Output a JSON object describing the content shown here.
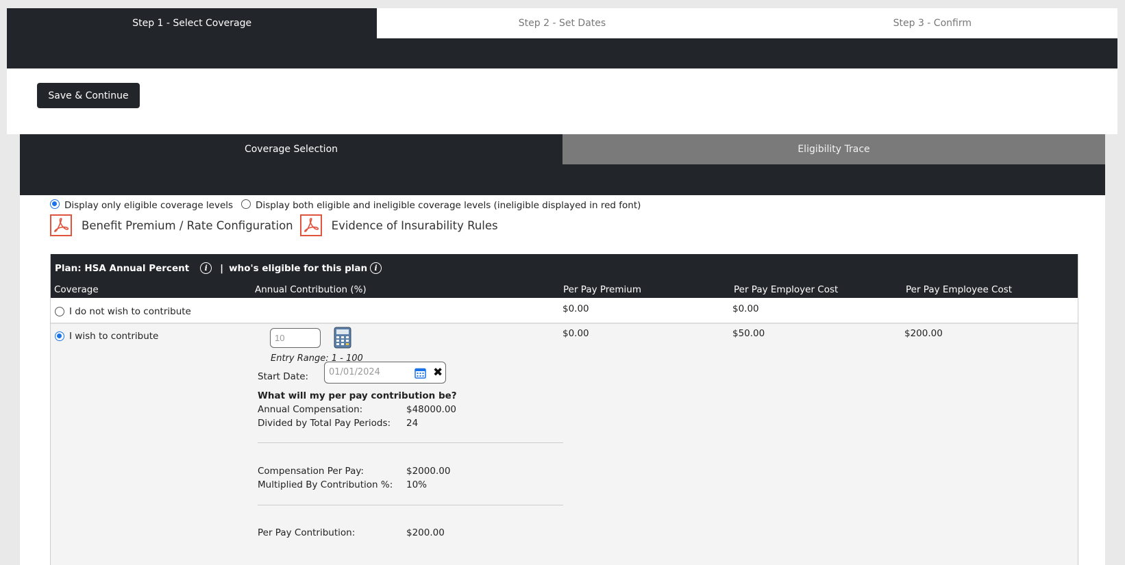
{
  "wizard": {
    "steps": [
      {
        "label": "Step 1 - Select Coverage"
      },
      {
        "label": "Step 2 - Set Dates"
      },
      {
        "label": "Step 3 - Confirm"
      }
    ]
  },
  "toolbar": {
    "save_label": "Save & Continue"
  },
  "subtabs": [
    {
      "label": "Coverage Selection"
    },
    {
      "label": "Eligibility Trace"
    }
  ],
  "display_options": {
    "eligible_only": "Display only eligible coverage levels",
    "both": "Display both eligible and ineligible coverage levels (ineligible displayed in red font)",
    "selected": "eligible_only"
  },
  "documents": [
    {
      "label": "Benefit Premium / Rate Configuration",
      "icon": "pdf-icon"
    },
    {
      "label": "Evidence of Insurability Rules",
      "icon": "pdf-icon"
    }
  ],
  "plan": {
    "title": "Plan: HSA Annual Percent",
    "separator": "|",
    "eligibility_link": "who's eligible for this plan",
    "columns": {
      "coverage": "Coverage",
      "contribution": "Annual Contribution (%)",
      "premium": "Per Pay Premium",
      "employer": "Per Pay Employer Cost",
      "employee": "Per Pay Employee Cost"
    },
    "rows": [
      {
        "label": "I do not wish to contribute",
        "premium": "$0.00",
        "employer": "$0.00",
        "employee": "",
        "selected": false
      },
      {
        "label": "I wish to contribute",
        "premium": "$0.00",
        "employer": "$50.00",
        "employee": "$200.00",
        "selected": true
      }
    ],
    "contribution": {
      "value": "10",
      "range": "Entry Range: 1 - 100",
      "start_date_label": "Start Date:",
      "start_date": "01/01/2024",
      "question": "What will my per pay contribution be?",
      "annual_comp_label": "Annual Compensation:",
      "annual_comp": "$48000.00",
      "pay_periods_label": "Divided by Total Pay Periods:",
      "pay_periods": "24",
      "comp_per_pay_label": "Compensation Per Pay:",
      "comp_per_pay": "$2000.00",
      "multiplied_label": "Multiplied By Contribution %:",
      "multiplied": "10%",
      "per_pay_label": "Per Pay Contribution:",
      "per_pay": "$200.00"
    }
  },
  "colors": {
    "dark": "#22252a",
    "accent": "#1a73e8",
    "pdf_red": "#e0533d",
    "inactive_tab": "#7a7a7a"
  }
}
